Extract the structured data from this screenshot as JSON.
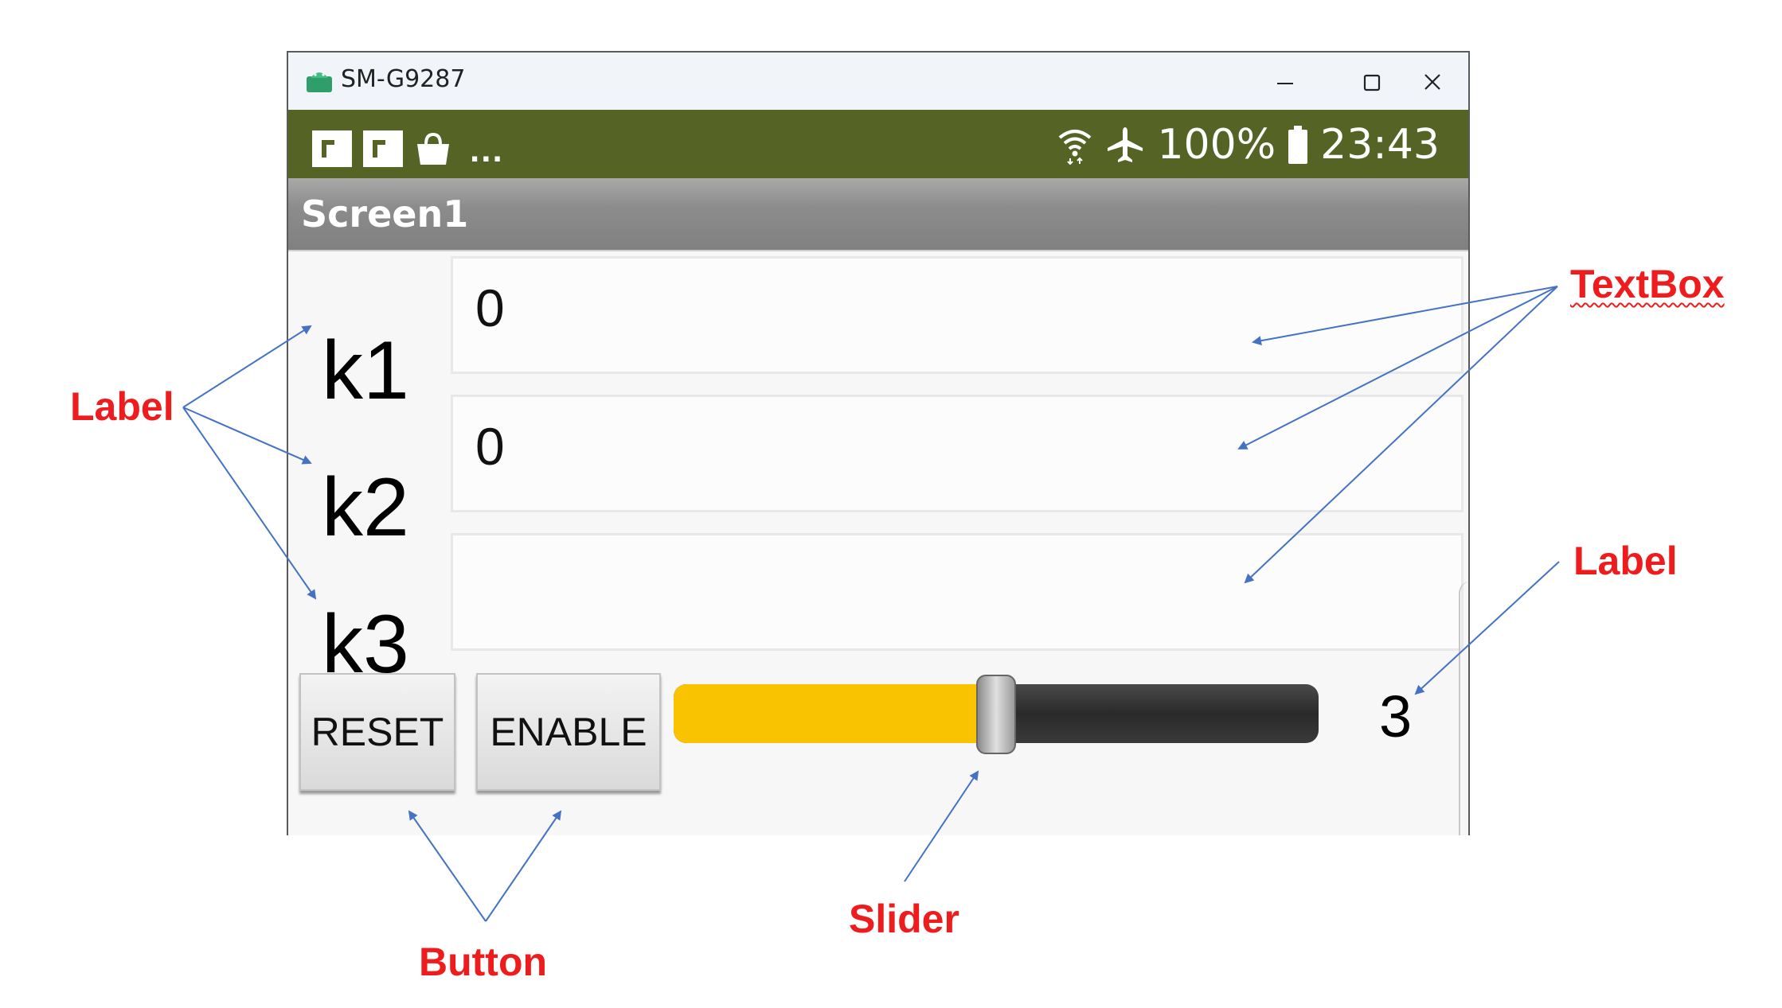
{
  "window": {
    "title": "SM-G9287",
    "controls": [
      "minimize",
      "maximize",
      "close"
    ]
  },
  "status_bar": {
    "left_icons": [
      "flipboard-icon",
      "flipboard-icon",
      "shopping-bag-icon"
    ],
    "overflow": "...",
    "battery_percent": "100%",
    "time": "23:43",
    "background_color": "#556325"
  },
  "app": {
    "screen_title": "Screen1",
    "rows": [
      {
        "label": "k1",
        "textbox_value": "0"
      },
      {
        "label": "k2",
        "textbox_value": "0"
      },
      {
        "label": "k3",
        "textbox_value": ""
      }
    ],
    "buttons": {
      "reset": "RESET",
      "enable": "ENABLE"
    },
    "slider": {
      "fraction": 0.5,
      "fill_color": "#f9c301"
    },
    "value_label": "3"
  },
  "annotations": {
    "label_left": "Label",
    "textbox": "TextBox",
    "label_right": "Label",
    "slider": "Slider",
    "button": "Button",
    "color": "#ee1c1c",
    "arrow_color": "#4472c4"
  }
}
